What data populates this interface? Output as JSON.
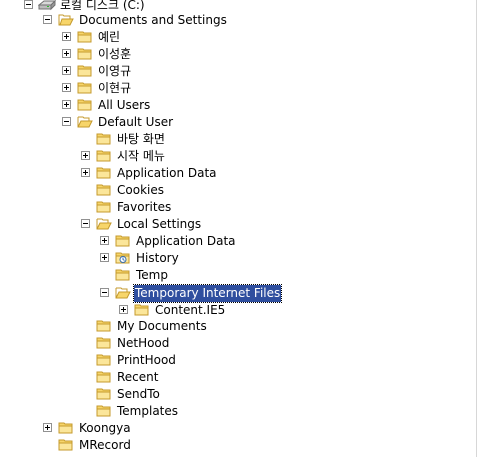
{
  "tree": {
    "drive": {
      "label": "로컬 디스크 (C:)",
      "icon": "drive-icon"
    },
    "documents_and_settings": {
      "label": "Documents and Settings"
    },
    "users": [
      {
        "label": "예린"
      },
      {
        "label": "이성훈"
      },
      {
        "label": "이영규"
      },
      {
        "label": "이현규"
      },
      {
        "label": "All Users"
      }
    ],
    "default_user": {
      "label": "Default User"
    },
    "default_user_children": [
      {
        "label": "바탕 화면",
        "expandable": false
      },
      {
        "label": "시작 메뉴",
        "expandable": true
      },
      {
        "label": "Application Data",
        "expandable": true
      },
      {
        "label": "Cookies",
        "expandable": false
      },
      {
        "label": "Favorites",
        "expandable": false
      },
      {
        "label": "Local Settings",
        "expandable": true,
        "expanded": true
      }
    ],
    "local_settings_children": [
      {
        "label": "Application Data",
        "expandable": true,
        "icon": "folder-icon"
      },
      {
        "label": "History",
        "expandable": true,
        "icon": "history-folder-icon"
      },
      {
        "label": "Temp",
        "expandable": false,
        "icon": "folder-icon"
      },
      {
        "label": "Temporary Internet Files",
        "expandable": true,
        "expanded": true,
        "selected": true,
        "icon": "folder-icon"
      }
    ],
    "temp_internet_children": [
      {
        "label": "Content.IE5",
        "expandable": true
      }
    ],
    "default_user_more": [
      {
        "label": "My Documents"
      },
      {
        "label": "NetHood"
      },
      {
        "label": "PrintHood"
      },
      {
        "label": "Recent"
      },
      {
        "label": "SendTo"
      },
      {
        "label": "Templates"
      }
    ],
    "root_more": [
      {
        "label": "Koongya",
        "expandable": true
      },
      {
        "label": "MRecord",
        "expandable": false
      }
    ]
  },
  "colors": {
    "folder_fill": "#f7d56a",
    "folder_edge": "#c49a2c",
    "selection": "#2f4f9f"
  }
}
